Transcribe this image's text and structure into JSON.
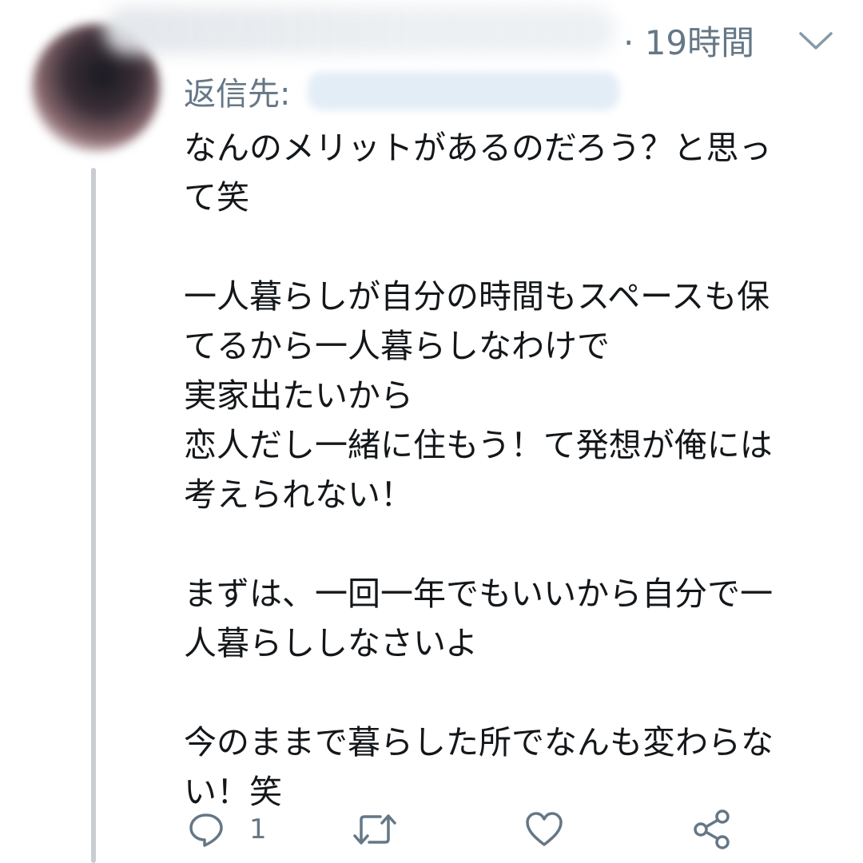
{
  "tweet": {
    "time_label": "· 19時間",
    "reply_to_label": "返信先:",
    "body_lines": [
      "なんのメリットがあるのだろう？と思っ",
      "て笑",
      "",
      "一人暮らしが自分の時間もスペースも保",
      "てるから一人暮らしなわけで",
      "実家出たいから",
      "恋人だし一緒に住もう！て発想が俺には",
      "考えられない！",
      "",
      "まずは、一回一年でもいいから自分で一",
      "人暮らししなさいよ",
      "",
      "今のままで暮らした所でなんも変わらな",
      "い！笑"
    ]
  },
  "actions": {
    "reply_count": "1",
    "reply_icon": "speech-bubble-icon",
    "retweet_icon": "retweet-arrows-icon",
    "like_icon": "heart-icon",
    "share_icon": "share-nodes-icon"
  },
  "colors": {
    "text": "#14171a",
    "secondary": "#657786",
    "thread_line": "#c8cdd2"
  }
}
